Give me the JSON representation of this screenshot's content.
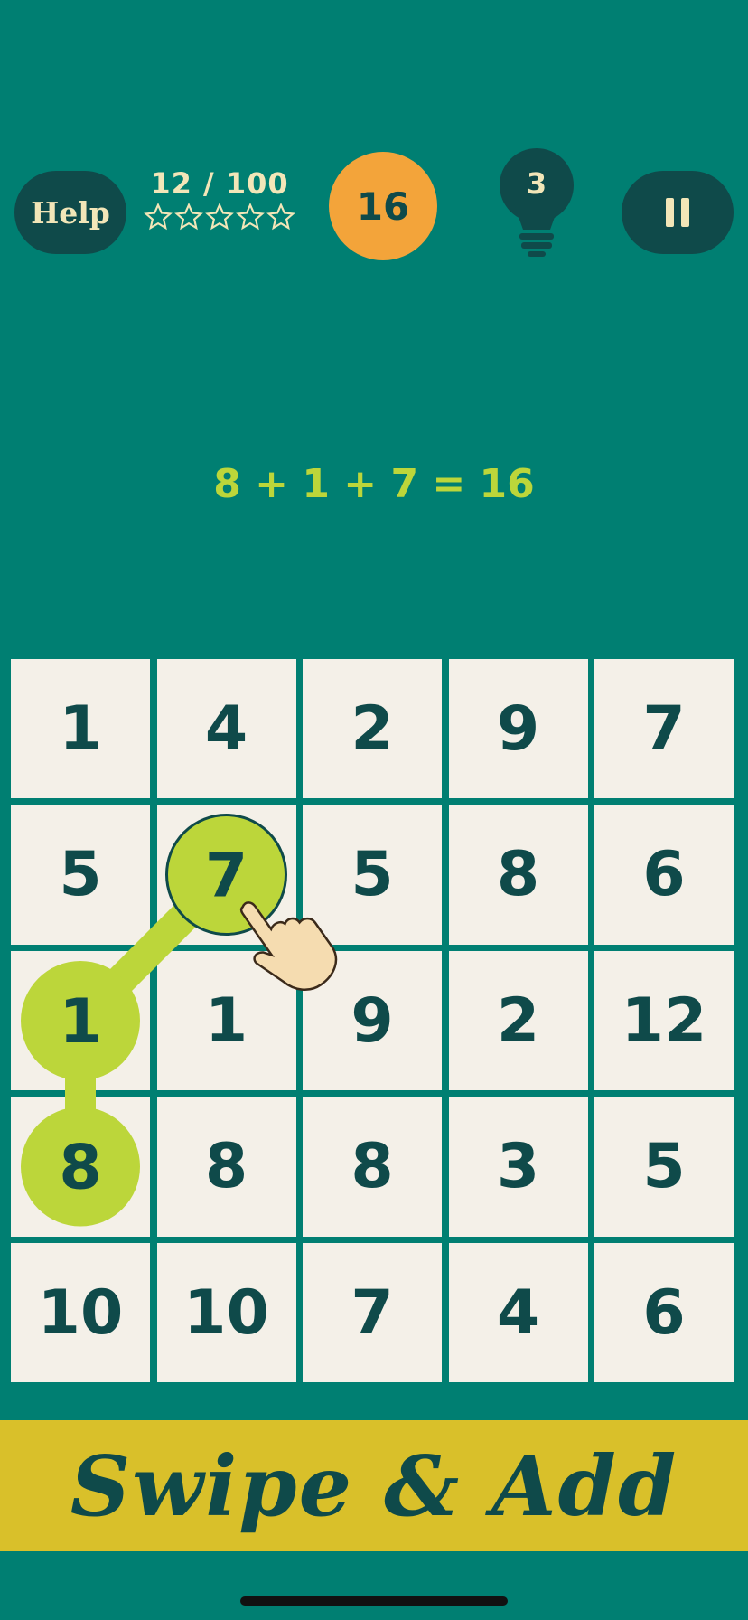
{
  "header": {
    "help_label": "Help",
    "level_progress": "12 / 100",
    "stars_total": 5,
    "stars_filled": 0,
    "target_sum": "16",
    "hints_count": "3"
  },
  "equation": "8 + 1 + 7 = 16",
  "grid": {
    "rows": 5,
    "cols": 5,
    "values": [
      [
        "1",
        "4",
        "2",
        "9",
        "7"
      ],
      [
        "5",
        "7",
        "5",
        "8",
        "6"
      ],
      [
        "1",
        "1",
        "9",
        "2",
        "12"
      ],
      [
        "8",
        "8",
        "8",
        "3",
        "5"
      ],
      [
        "10",
        "10",
        "7",
        "4",
        "6"
      ]
    ],
    "selected_path": [
      [
        3,
        0
      ],
      [
        2,
        0
      ],
      [
        1,
        1
      ]
    ]
  },
  "banner": "Swipe & Add",
  "colors": {
    "background": "#007f72",
    "dark": "#0f4a4a",
    "accent_green": "#bcd63a",
    "target_orange": "#f3a43a",
    "banner_yellow": "#d9c02a",
    "cell": "#f4f0e8"
  }
}
